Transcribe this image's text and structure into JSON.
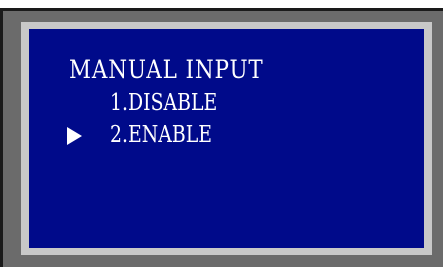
{
  "menu": {
    "title": "MANUAL INPUT",
    "options": [
      {
        "label": "1.DISABLE",
        "selected": false
      },
      {
        "label": "2.ENABLE",
        "selected": true
      }
    ],
    "cursor_icon": "play-triangle-icon"
  },
  "colors": {
    "panel_background": "#000a8a",
    "text": "#ffffff",
    "outer_frame": "#6b6b6b",
    "inner_bezel": "#c8c8c8"
  }
}
